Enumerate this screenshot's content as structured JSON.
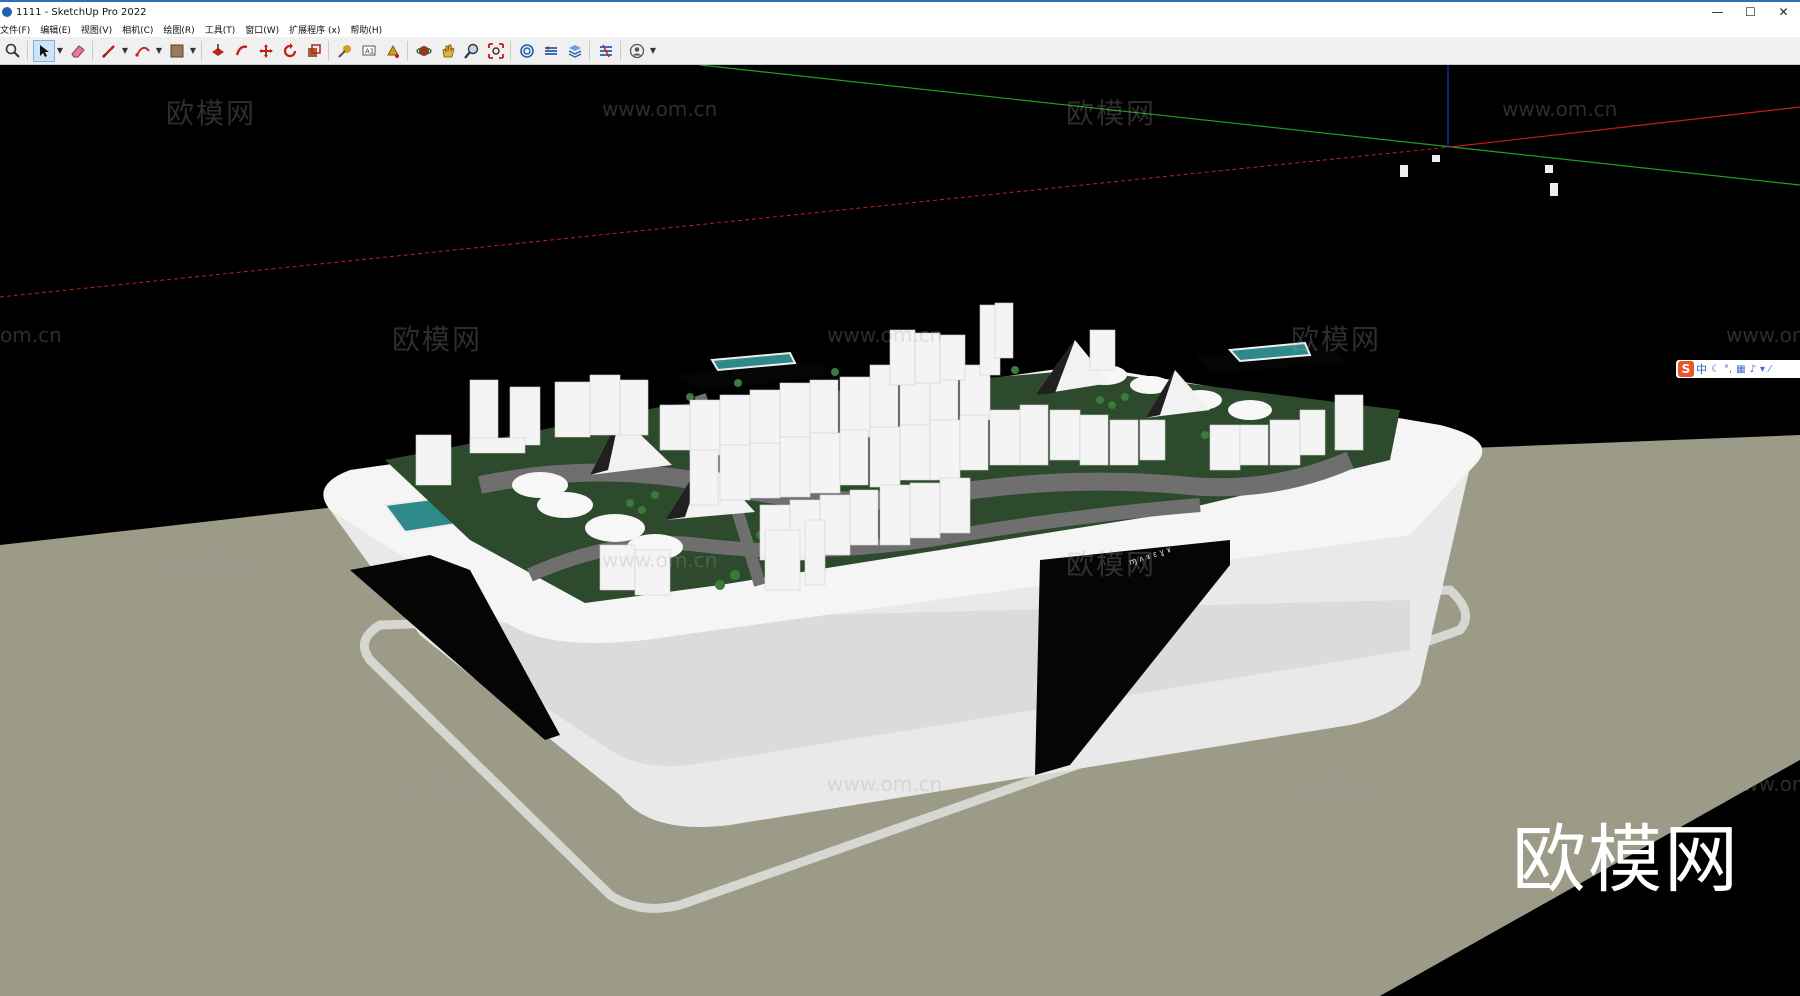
{
  "window": {
    "title": "1111 - SketchUp Pro 2022",
    "controls": {
      "minimize": "—",
      "maximize": "☐",
      "close": "✕"
    }
  },
  "menu": {
    "items": [
      "文件(F)",
      "编辑(E)",
      "视图(V)",
      "相机(C)",
      "绘图(R)",
      "工具(T)",
      "窗口(W)",
      "扩展程序 (x)",
      "帮助(H)"
    ]
  },
  "toolbar": {
    "tools": [
      "search-icon",
      "select-icon",
      "eraser-icon",
      "pencil-line-icon",
      "arc-icon",
      "material-bucket-icon",
      "push-pull-icon",
      "follow-me-icon",
      "move-icon",
      "rotate-icon",
      "scale-icon",
      "tape-measure-icon",
      "text-icon",
      "paint-icon",
      "orbit-icon",
      "pan-icon",
      "zoom-icon",
      "zoom-extents-icon",
      "warehouse-icon",
      "extension-icon",
      "layers-icon",
      "extension-manager-icon",
      "account-icon"
    ]
  },
  "watermarks": {
    "brand": "欧模网",
    "url": "www.om.cn",
    "partial_url": "om.cn"
  },
  "logo": {
    "text": "欧模网"
  },
  "ime": {
    "logo": "S",
    "mode": "中",
    "icons": [
      "moon-icon",
      "punctuation-icon",
      "keyboard-icon",
      "mic-icon",
      "shirt-icon",
      "more-icon"
    ]
  },
  "colors": {
    "background": "#000000",
    "ground": "#9b9b88",
    "model_white": "#f2f2f2",
    "grass": "#2d4a2c",
    "road": "#6f6f6f",
    "panel_black": "#050505",
    "axis_red": "#c02020",
    "axis_green": "#20a020",
    "axis_blue": "#2030d0"
  }
}
